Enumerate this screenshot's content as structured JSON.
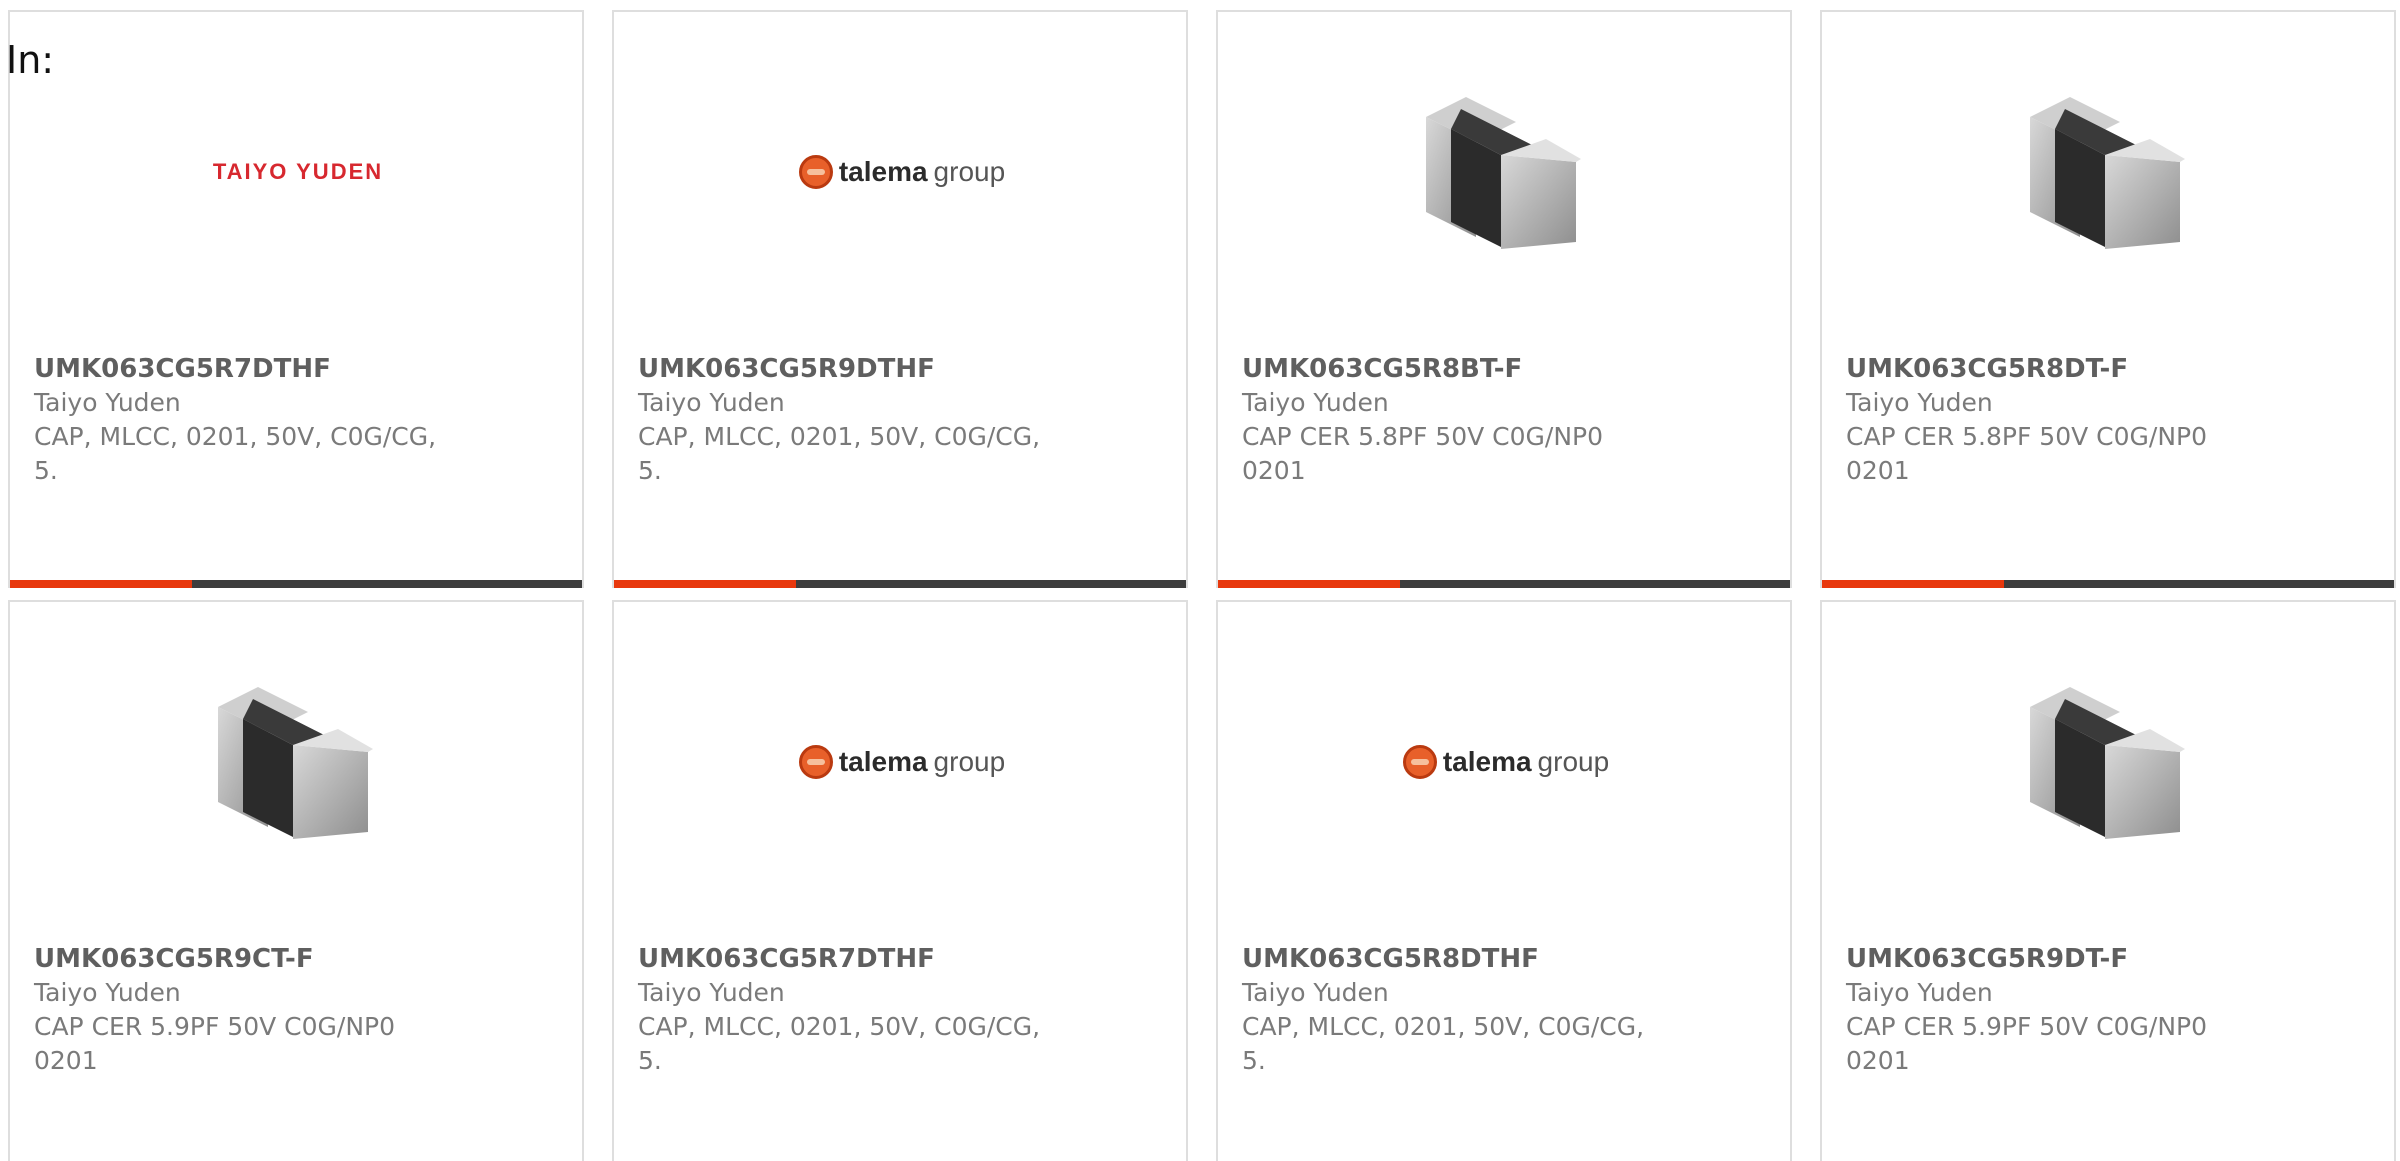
{
  "header": {
    "prefix": "In:"
  },
  "colors": {
    "accent": "#e8380d",
    "bar": "#3d3d3d",
    "brand_taiyo": "#d7282f",
    "brand_talema": "#e8602a"
  },
  "cards": [
    {
      "part_number": "UMK063CG5R7DTHF",
      "manufacturer": "Taiyo Yuden",
      "desc_line1": "CAP, MLCC, 0201, 50V, C0G/CG,",
      "desc_line2": "5.",
      "image": "taiyo-yuden-logo",
      "logo_text": "TAIYO YUDEN"
    },
    {
      "part_number": "UMK063CG5R9DTHF",
      "manufacturer": "Taiyo Yuden",
      "desc_line1": "CAP, MLCC, 0201, 50V, C0G/CG,",
      "desc_line2": "5.",
      "image": "talema-group-logo",
      "logo_bold": "talema",
      "logo_light": "group"
    },
    {
      "part_number": "UMK063CG5R8BT-F",
      "manufacturer": "Taiyo Yuden",
      "desc_line1": "CAP CER 5.8PF 50V C0G/NP0",
      "desc_line2": "0201",
      "image": "mlcc-chip-capacitor"
    },
    {
      "part_number": "UMK063CG5R8DT-F",
      "manufacturer": "Taiyo Yuden",
      "desc_line1": "CAP CER 5.8PF 50V C0G/NP0",
      "desc_line2": "0201",
      "image": "mlcc-chip-capacitor"
    },
    {
      "part_number": "UMK063CG5R9CT-F",
      "manufacturer": "Taiyo Yuden",
      "desc_line1": "CAP CER 5.9PF 50V C0G/NP0",
      "desc_line2": "0201",
      "image": "mlcc-chip-capacitor"
    },
    {
      "part_number": "UMK063CG5R7DTHF",
      "manufacturer": "Taiyo Yuden",
      "desc_line1": "CAP, MLCC, 0201, 50V, C0G/CG,",
      "desc_line2": "5.",
      "image": "talema-group-logo",
      "logo_bold": "talema",
      "logo_light": "group"
    },
    {
      "part_number": "UMK063CG5R8DTHF",
      "manufacturer": "Taiyo Yuden",
      "desc_line1": "CAP, MLCC, 0201, 50V, C0G/CG,",
      "desc_line2": "5.",
      "image": "talema-group-logo",
      "logo_bold": "talema",
      "logo_light": "group"
    },
    {
      "part_number": "UMK063CG5R9DT-F",
      "manufacturer": "Taiyo Yuden",
      "desc_line1": "CAP CER 5.9PF 50V C0G/NP0",
      "desc_line2": "0201",
      "image": "mlcc-chip-capacitor"
    }
  ]
}
